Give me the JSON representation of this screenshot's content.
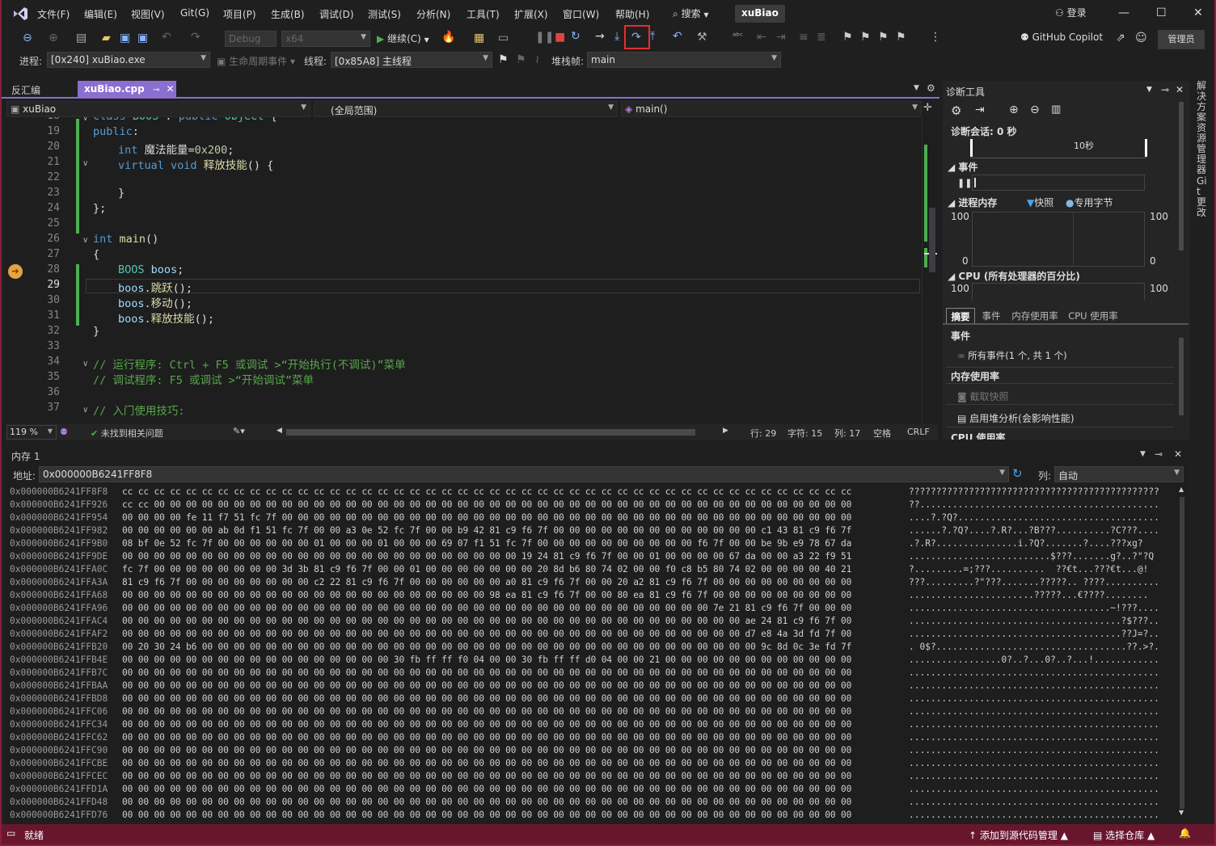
{
  "title_bar": {
    "menu": [
      "文件(F)",
      "编辑(E)",
      "视图(V)",
      "Git(G)",
      "项目(P)",
      "生成(B)",
      "调试(D)",
      "测试(S)",
      "分析(N)",
      "工具(T)",
      "扩展(X)",
      "窗口(W)",
      "帮助(H)"
    ],
    "search_label": "搜索",
    "solution_name": "xuBiao",
    "login_label": "登录",
    "accent_color": "#8a1d3b"
  },
  "toolbar": {
    "config": "Debug",
    "platform": "x64",
    "continue_label": "继续(C)",
    "copilot_label": "GitHub Copilot",
    "admin_label": "管理员"
  },
  "debug_location": {
    "process_label": "进程:",
    "process_value": "[0x240] xuBiao.exe",
    "lifecycle_label": "生命周期事件",
    "thread_label": "线程:",
    "thread_value": "[0x85A8] 主线程",
    "stackframe_label": "堆栈帧:",
    "stackframe_value": "main"
  },
  "doc_tabs": {
    "disasm": "反汇编",
    "active": "xuBiao.cpp"
  },
  "navbar": {
    "project": "xuBiao",
    "scope": "(全局范围)",
    "member": "main()"
  },
  "editor": {
    "lines": [
      {
        "n": "18",
        "text": "class BOOS : public Object {"
      },
      {
        "n": "19",
        "text": "public:"
      },
      {
        "n": "20",
        "text": "int 魔法能量=0x200;"
      },
      {
        "n": "21",
        "text": "virtual void 释放技能() {"
      },
      {
        "n": "22",
        "text": ""
      },
      {
        "n": "23",
        "text": "}"
      },
      {
        "n": "24",
        "text": "};"
      },
      {
        "n": "25",
        "text": ""
      },
      {
        "n": "26",
        "text": "int main()"
      },
      {
        "n": "27",
        "text": "{"
      },
      {
        "n": "28",
        "text": "BOOS boos;"
      },
      {
        "n": "29",
        "text": "boos.跳跃();"
      },
      {
        "n": "30",
        "text": "boos.移动();"
      },
      {
        "n": "31",
        "text": "boos.释放技能();"
      },
      {
        "n": "32",
        "text": "}"
      },
      {
        "n": "33",
        "text": ""
      },
      {
        "n": "34",
        "text": "// 运行程序: Ctrl + F5 或调试 >“开始执行(不调试)”菜单"
      },
      {
        "n": "35",
        "text": "// 调试程序: F5 或调试 >“开始调试”菜单"
      },
      {
        "n": "36",
        "text": ""
      },
      {
        "n": "37",
        "text": "// 入门使用技巧:"
      }
    ],
    "zoom": "119 %",
    "issues": "未找到相关问题",
    "line_info": "行: 29",
    "char_info": "字符: 15",
    "col_info": "列: 17",
    "space_info": "空格",
    "eol_info": "CRLF"
  },
  "diagnostics": {
    "title": "诊断工具",
    "session": "诊断会话: 0 秒",
    "timeline_label": "10秒",
    "events_header": "事件",
    "process_memory": "进程内存",
    "snapshot": "快照",
    "private_bytes": "专用字节",
    "mem_max_left": "100",
    "mem_max_right": "100",
    "mem_min_left": "0",
    "mem_min_right": "0",
    "cpu_header": "CPU (所有处理器的百分比)",
    "cpu_max_left": "100",
    "cpu_max_right": "100",
    "tabs": [
      "摘要",
      "事件",
      "内存使用率",
      "CPU 使用率"
    ],
    "summary_events": "事件",
    "all_events": "所有事件(1 个, 共 1 个)",
    "memory_usage": "内存使用率",
    "take_snapshot": "截取快照",
    "heap_analysis": "启用堆分析(会影响性能)",
    "cpu_usage": "CPU 使用率"
  },
  "right_tabs": [
    "解决方案资源管理器",
    "Git 更改"
  ],
  "memory": {
    "title": "内存 1",
    "address_label": "地址:",
    "address_value": "0x000000B6241FF8F8",
    "col_label": "列:",
    "col_value": "自动",
    "rows": [
      {
        "a": "0x000000B6241FF8F8",
        "h": "cc cc cc cc cc cc cc cc cc cc cc cc cc cc cc cc cc cc cc cc cc cc cc cc cc cc cc cc cc cc cc cc cc cc cc cc cc cc cc cc cc cc cc cc cc cc",
        "s": "??????????????????????????????????????????????"
      },
      {
        "a": "0x000000B6241FF926",
        "h": "cc cc 00 00 00 00 00 00 00 00 00 00 00 00 00 00 00 00 00 00 00 00 00 00 00 00 00 00 00 00 00 00 00 00 00 00 00 00 00 00 00 00 00 00 00 00",
        "s": "??............................................"
      },
      {
        "a": "0x000000B6241FF954",
        "h": "00 00 00 00 fe 11 f7 51 fc 7f 00 00 00 00 00 00 00 00 00 00 00 00 00 00 00 00 00 00 00 00 00 00 00 00 00 00 00 00 00 00 00 00 00 00 00 00",
        "s": "....?.?Q?....................................."
      },
      {
        "a": "0x000000B6241FF982",
        "h": "00 00 00 00 00 00 ab 0d f1 51 fc 7f 00 00 a3 0e 52 fc 7f 00 00 b9 42 81 c9 f6 7f 00 00 00 00 00 00 00 00 00 00 00 00 00 c1 43 81 c9 f6 7f",
        "s": "......?.?Q?....?.R?...?B???..........?C???...."
      },
      {
        "a": "0x000000B6241FF9B0",
        "h": "08 bf 0e 52 fc 7f 00 00 00 00 00 00 01 00 00 00 01 00 00 00 69 07 f1 51 fc 7f 00 00 00 00 00 00 00 00 00 00 f6 7f 00 00 be 9b e9 78 67 da",
        "s": ".?.R?...............i.?Q?.......?....???xg?"
      },
      {
        "a": "0x000000B6241FF9DE",
        "h": "00 00 00 00 00 00 00 00 00 00 00 00 00 00 00 00 00 00 00 00 00 00 00 00 00 19 24 81 c9 f6 7f 00 00 01 00 00 00 00 67 da 00 00 a3 22 f9 51",
        "s": "..........................$???.......g?..?\"?Q"
      },
      {
        "a": "0x000000B6241FFA0C",
        "h": "fc 7f 00 00 00 00 00 00 00 00 3d 3b 81 c9 f6 7f 00 00 01 00 00 00 00 00 00 00 20 8d b6 80 74 02 00 00 f0 c8 b5 80 74 02 00 00 00 00 40 21",
        "s": "?.........=;???..........  ??€t...???€t...@!"
      },
      {
        "a": "0x000000B6241FFA3A",
        "h": "81 c9 f6 7f 00 00 00 00 00 00 00 00 c2 22 81 c9 f6 7f 00 00 00 00 00 00 a0 81 c9 f6 7f 00 00 20 a2 81 c9 f6 7f 00 00 00 00 00 00 00 00 00",
        "s": "???.........?\"???.......?????.. ????.........."
      },
      {
        "a": "0x000000B6241FFA68",
        "h": "00 00 00 00 00 00 00 00 00 00 00 00 00 00 00 00 00 00 00 00 00 00 00 98 ea 81 c9 f6 7f 00 00 80 ea 81 c9 f6 7f 00 00 00 00 00 00 00 00 00",
        "s": ".......................?????...€????........"
      },
      {
        "a": "0x000000B6241FFA96",
        "h": "00 00 00 00 00 00 00 00 00 00 00 00 00 00 00 00 00 00 00 00 00 00 00 00 00 00 00 00 00 00 00 00 00 00 00 00 00 7e 21 81 c9 f6 7f 00 00 00",
        "s": ".....................................~!???...."
      },
      {
        "a": "0x000000B6241FFAC4",
        "h": "00 00 00 00 00 00 00 00 00 00 00 00 00 00 00 00 00 00 00 00 00 00 00 00 00 00 00 00 00 00 00 00 00 00 00 00 00 00 00 ae 24 81 c9 f6 7f 00",
        "s": ".......................................?$???.."
      },
      {
        "a": "0x000000B6241FFAF2",
        "h": "00 00 00 00 00 00 00 00 00 00 00 00 00 00 00 00 00 00 00 00 00 00 00 00 00 00 00 00 00 00 00 00 00 00 00 00 00 00 00 d7 e8 4a 3d fd 7f 00",
        "s": ".......................................??J=?.."
      },
      {
        "a": "0x000000B6241FFB20",
        "h": "00 20 30 24 b6 00 00 00 00 00 00 00 00 00 00 00 00 00 00 00 00 00 00 00 00 00 00 00 00 00 00 00 00 00 00 00 00 00 00 00 9c 8d 0c 3e fd 7f",
        "s": ". 0$?...................................??.>?."
      },
      {
        "a": "0x000000B6241FFB4E",
        "h": "00 00 00 00 00 00 00 00 00 00 00 00 00 00 00 00 00 30 fb ff ff f0 04 00 00 30 fb ff ff d0 04 00 00 21 00 00 00 00 00 00 00 00 00 00 00 00",
        "s": ".................0?..?...0?..?...!............"
      },
      {
        "a": "0x000000B6241FFB7C",
        "h": "00 00 00 00 00 00 00 00 00 00 00 00 00 00 00 00 00 00 00 00 00 00 00 00 00 00 00 00 00 00 00 00 00 00 00 00 00 00 00 00 00 00 00 00 00 00",
        "s": ".............................................."
      },
      {
        "a": "0x000000B6241FFBAA",
        "h": "00 00 00 00 00 00 00 00 00 00 00 00 00 00 00 00 00 00 00 00 00 00 00 00 00 00 00 00 00 00 00 00 00 00 00 00 00 00 00 00 00 00 00 00 00 00",
        "s": ".............................................."
      },
      {
        "a": "0x000000B6241FFBD8",
        "h": "00 00 00 00 00 00 00 00 00 00 00 00 00 00 00 00 00 00 00 00 00 00 00 00 00 00 00 00 00 00 00 00 00 00 00 00 00 00 00 00 00 00 00 00 00 00",
        "s": ".............................................."
      },
      {
        "a": "0x000000B6241FFC06",
        "h": "00 00 00 00 00 00 00 00 00 00 00 00 00 00 00 00 00 00 00 00 00 00 00 00 00 00 00 00 00 00 00 00 00 00 00 00 00 00 00 00 00 00 00 00 00 00",
        "s": ".............................................."
      },
      {
        "a": "0x000000B6241FFC34",
        "h": "00 00 00 00 00 00 00 00 00 00 00 00 00 00 00 00 00 00 00 00 00 00 00 00 00 00 00 00 00 00 00 00 00 00 00 00 00 00 00 00 00 00 00 00 00 00",
        "s": ".............................................."
      },
      {
        "a": "0x000000B6241FFC62",
        "h": "00 00 00 00 00 00 00 00 00 00 00 00 00 00 00 00 00 00 00 00 00 00 00 00 00 00 00 00 00 00 00 00 00 00 00 00 00 00 00 00 00 00 00 00 00 00",
        "s": ".............................................."
      },
      {
        "a": "0x000000B6241FFC90",
        "h": "00 00 00 00 00 00 00 00 00 00 00 00 00 00 00 00 00 00 00 00 00 00 00 00 00 00 00 00 00 00 00 00 00 00 00 00 00 00 00 00 00 00 00 00 00 00",
        "s": ".............................................."
      },
      {
        "a": "0x000000B6241FFCBE",
        "h": "00 00 00 00 00 00 00 00 00 00 00 00 00 00 00 00 00 00 00 00 00 00 00 00 00 00 00 00 00 00 00 00 00 00 00 00 00 00 00 00 00 00 00 00 00 00",
        "s": ".............................................."
      },
      {
        "a": "0x000000B6241FFCEC",
        "h": "00 00 00 00 00 00 00 00 00 00 00 00 00 00 00 00 00 00 00 00 00 00 00 00 00 00 00 00 00 00 00 00 00 00 00 00 00 00 00 00 00 00 00 00 00 00",
        "s": ".............................................."
      },
      {
        "a": "0x000000B6241FFD1A",
        "h": "00 00 00 00 00 00 00 00 00 00 00 00 00 00 00 00 00 00 00 00 00 00 00 00 00 00 00 00 00 00 00 00 00 00 00 00 00 00 00 00 00 00 00 00 00 00",
        "s": ".............................................."
      },
      {
        "a": "0x000000B6241FFD48",
        "h": "00 00 00 00 00 00 00 00 00 00 00 00 00 00 00 00 00 00 00 00 00 00 00 00 00 00 00 00 00 00 00 00 00 00 00 00 00 00 00 00 00 00 00 00 00 00",
        "s": ".............................................."
      },
      {
        "a": "0x000000B6241FFD76",
        "h": "00 00 00 00 00 00 00 00 00 00 00 00 00 00 00 00 00 00 00 00 00 00 00 00 00 00 00 00 00 00 00 00 00 00 00 00 00 00 00 00 00 00 00 00 00 00",
        "s": ".............................................."
      }
    ]
  },
  "status_bar": {
    "ready": "就绪",
    "add_source_control": "添加到源代码管理",
    "select_repo": "选择仓库"
  }
}
